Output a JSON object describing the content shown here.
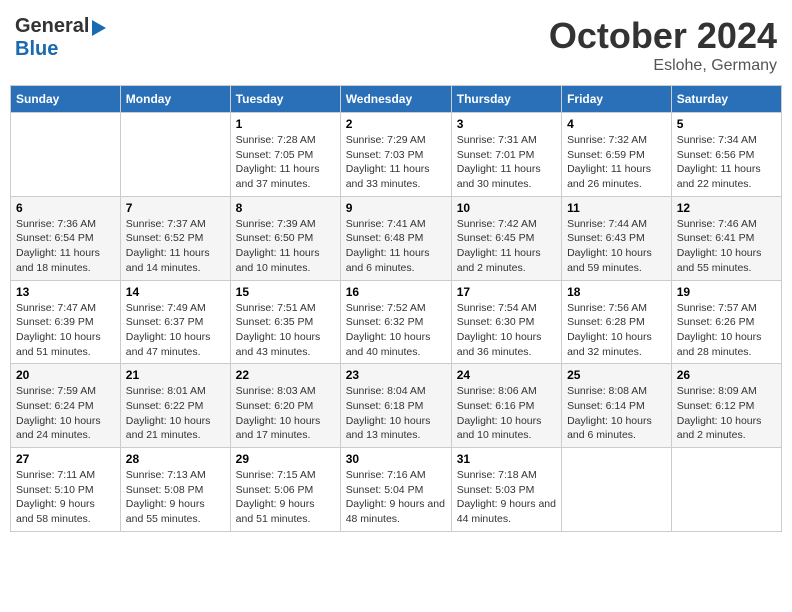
{
  "header": {
    "logo_general": "General",
    "logo_blue": "Blue",
    "title": "October 2024",
    "location": "Eslohe, Germany"
  },
  "days_of_week": [
    "Sunday",
    "Monday",
    "Tuesday",
    "Wednesday",
    "Thursday",
    "Friday",
    "Saturday"
  ],
  "weeks": [
    [
      {
        "day": "",
        "info": ""
      },
      {
        "day": "",
        "info": ""
      },
      {
        "day": "1",
        "info": "Sunrise: 7:28 AM\nSunset: 7:05 PM\nDaylight: 11 hours and 37 minutes."
      },
      {
        "day": "2",
        "info": "Sunrise: 7:29 AM\nSunset: 7:03 PM\nDaylight: 11 hours and 33 minutes."
      },
      {
        "day": "3",
        "info": "Sunrise: 7:31 AM\nSunset: 7:01 PM\nDaylight: 11 hours and 30 minutes."
      },
      {
        "day": "4",
        "info": "Sunrise: 7:32 AM\nSunset: 6:59 PM\nDaylight: 11 hours and 26 minutes."
      },
      {
        "day": "5",
        "info": "Sunrise: 7:34 AM\nSunset: 6:56 PM\nDaylight: 11 hours and 22 minutes."
      }
    ],
    [
      {
        "day": "6",
        "info": "Sunrise: 7:36 AM\nSunset: 6:54 PM\nDaylight: 11 hours and 18 minutes."
      },
      {
        "day": "7",
        "info": "Sunrise: 7:37 AM\nSunset: 6:52 PM\nDaylight: 11 hours and 14 minutes."
      },
      {
        "day": "8",
        "info": "Sunrise: 7:39 AM\nSunset: 6:50 PM\nDaylight: 11 hours and 10 minutes."
      },
      {
        "day": "9",
        "info": "Sunrise: 7:41 AM\nSunset: 6:48 PM\nDaylight: 11 hours and 6 minutes."
      },
      {
        "day": "10",
        "info": "Sunrise: 7:42 AM\nSunset: 6:45 PM\nDaylight: 11 hours and 2 minutes."
      },
      {
        "day": "11",
        "info": "Sunrise: 7:44 AM\nSunset: 6:43 PM\nDaylight: 10 hours and 59 minutes."
      },
      {
        "day": "12",
        "info": "Sunrise: 7:46 AM\nSunset: 6:41 PM\nDaylight: 10 hours and 55 minutes."
      }
    ],
    [
      {
        "day": "13",
        "info": "Sunrise: 7:47 AM\nSunset: 6:39 PM\nDaylight: 10 hours and 51 minutes."
      },
      {
        "day": "14",
        "info": "Sunrise: 7:49 AM\nSunset: 6:37 PM\nDaylight: 10 hours and 47 minutes."
      },
      {
        "day": "15",
        "info": "Sunrise: 7:51 AM\nSunset: 6:35 PM\nDaylight: 10 hours and 43 minutes."
      },
      {
        "day": "16",
        "info": "Sunrise: 7:52 AM\nSunset: 6:32 PM\nDaylight: 10 hours and 40 minutes."
      },
      {
        "day": "17",
        "info": "Sunrise: 7:54 AM\nSunset: 6:30 PM\nDaylight: 10 hours and 36 minutes."
      },
      {
        "day": "18",
        "info": "Sunrise: 7:56 AM\nSunset: 6:28 PM\nDaylight: 10 hours and 32 minutes."
      },
      {
        "day": "19",
        "info": "Sunrise: 7:57 AM\nSunset: 6:26 PM\nDaylight: 10 hours and 28 minutes."
      }
    ],
    [
      {
        "day": "20",
        "info": "Sunrise: 7:59 AM\nSunset: 6:24 PM\nDaylight: 10 hours and 24 minutes."
      },
      {
        "day": "21",
        "info": "Sunrise: 8:01 AM\nSunset: 6:22 PM\nDaylight: 10 hours and 21 minutes."
      },
      {
        "day": "22",
        "info": "Sunrise: 8:03 AM\nSunset: 6:20 PM\nDaylight: 10 hours and 17 minutes."
      },
      {
        "day": "23",
        "info": "Sunrise: 8:04 AM\nSunset: 6:18 PM\nDaylight: 10 hours and 13 minutes."
      },
      {
        "day": "24",
        "info": "Sunrise: 8:06 AM\nSunset: 6:16 PM\nDaylight: 10 hours and 10 minutes."
      },
      {
        "day": "25",
        "info": "Sunrise: 8:08 AM\nSunset: 6:14 PM\nDaylight: 10 hours and 6 minutes."
      },
      {
        "day": "26",
        "info": "Sunrise: 8:09 AM\nSunset: 6:12 PM\nDaylight: 10 hours and 2 minutes."
      }
    ],
    [
      {
        "day": "27",
        "info": "Sunrise: 7:11 AM\nSunset: 5:10 PM\nDaylight: 9 hours and 58 minutes."
      },
      {
        "day": "28",
        "info": "Sunrise: 7:13 AM\nSunset: 5:08 PM\nDaylight: 9 hours and 55 minutes."
      },
      {
        "day": "29",
        "info": "Sunrise: 7:15 AM\nSunset: 5:06 PM\nDaylight: 9 hours and 51 minutes."
      },
      {
        "day": "30",
        "info": "Sunrise: 7:16 AM\nSunset: 5:04 PM\nDaylight: 9 hours and 48 minutes."
      },
      {
        "day": "31",
        "info": "Sunrise: 7:18 AM\nSunset: 5:03 PM\nDaylight: 9 hours and 44 minutes."
      },
      {
        "day": "",
        "info": ""
      },
      {
        "day": "",
        "info": ""
      }
    ]
  ]
}
